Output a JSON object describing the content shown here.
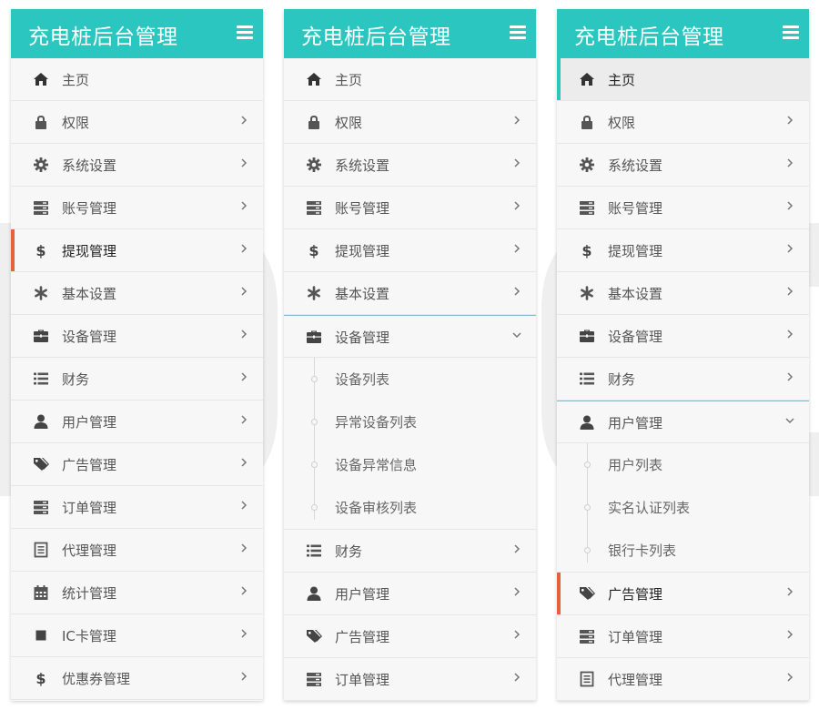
{
  "title": "充电桩后台管理",
  "colors": {
    "header": "#2bc6bf",
    "accent_red": "#e8603c",
    "accent_teal": "#2bc6bf",
    "open_border": "#8bb4c8"
  },
  "panels": [
    {
      "items": [
        {
          "icon": "home",
          "label": "主页",
          "chevron": ""
        },
        {
          "icon": "lock",
          "label": "权限",
          "chevron": "right"
        },
        {
          "icon": "gear",
          "label": "系统设置",
          "chevron": "right"
        },
        {
          "icon": "server",
          "label": "账号管理",
          "chevron": "right"
        },
        {
          "icon": "dollar",
          "label": "提现管理",
          "chevron": "right",
          "state": "active",
          "accent": "#e8603c"
        },
        {
          "icon": "asterisk",
          "label": "基本设置",
          "chevron": "right"
        },
        {
          "icon": "briefcase",
          "label": "设备管理",
          "chevron": "right"
        },
        {
          "icon": "list",
          "label": "财务",
          "chevron": "right"
        },
        {
          "icon": "user",
          "label": "用户管理",
          "chevron": "right"
        },
        {
          "icon": "tags",
          "label": "广告管理",
          "chevron": "right"
        },
        {
          "icon": "server",
          "label": "订单管理",
          "chevron": "right"
        },
        {
          "icon": "doc",
          "label": "代理管理",
          "chevron": "right"
        },
        {
          "icon": "calendar",
          "label": "统计管理",
          "chevron": "right"
        },
        {
          "icon": "square",
          "label": "IC卡管理",
          "chevron": "right"
        },
        {
          "icon": "dollar",
          "label": "优惠券管理",
          "chevron": "right"
        }
      ]
    },
    {
      "items": [
        {
          "icon": "home",
          "label": "主页",
          "chevron": ""
        },
        {
          "icon": "lock",
          "label": "权限",
          "chevron": "right"
        },
        {
          "icon": "gear",
          "label": "系统设置",
          "chevron": "right"
        },
        {
          "icon": "server",
          "label": "账号管理",
          "chevron": "right"
        },
        {
          "icon": "dollar",
          "label": "提现管理",
          "chevron": "right"
        },
        {
          "icon": "asterisk",
          "label": "基本设置",
          "chevron": "right"
        },
        {
          "icon": "briefcase",
          "label": "设备管理",
          "chevron": "down",
          "state": "open",
          "sub": [
            "设备列表",
            "异常设备列表",
            "设备异常信息",
            "设备审核列表"
          ]
        },
        {
          "icon": "list",
          "label": "财务",
          "chevron": "right"
        },
        {
          "icon": "user",
          "label": "用户管理",
          "chevron": "right"
        },
        {
          "icon": "tags",
          "label": "广告管理",
          "chevron": "right"
        },
        {
          "icon": "server",
          "label": "订单管理",
          "chevron": "right"
        }
      ]
    },
    {
      "items": [
        {
          "icon": "home",
          "label": "主页",
          "chevron": "",
          "state": "home-active",
          "accent": "#2bc6bf"
        },
        {
          "icon": "lock",
          "label": "权限",
          "chevron": "right"
        },
        {
          "icon": "gear",
          "label": "系统设置",
          "chevron": "right"
        },
        {
          "icon": "server",
          "label": "账号管理",
          "chevron": "right"
        },
        {
          "icon": "dollar",
          "label": "提现管理",
          "chevron": "right"
        },
        {
          "icon": "asterisk",
          "label": "基本设置",
          "chevron": "right"
        },
        {
          "icon": "briefcase",
          "label": "设备管理",
          "chevron": "right"
        },
        {
          "icon": "list",
          "label": "财务",
          "chevron": "right"
        },
        {
          "icon": "user",
          "label": "用户管理",
          "chevron": "down",
          "state": "open",
          "sub": [
            "用户列表",
            "实名认证列表",
            "银行卡列表"
          ]
        },
        {
          "icon": "tags",
          "label": "广告管理",
          "chevron": "right",
          "state": "active",
          "accent": "#e8603c"
        },
        {
          "icon": "server",
          "label": "订单管理",
          "chevron": "right"
        },
        {
          "icon": "doc",
          "label": "代理管理",
          "chevron": "right"
        }
      ]
    }
  ]
}
